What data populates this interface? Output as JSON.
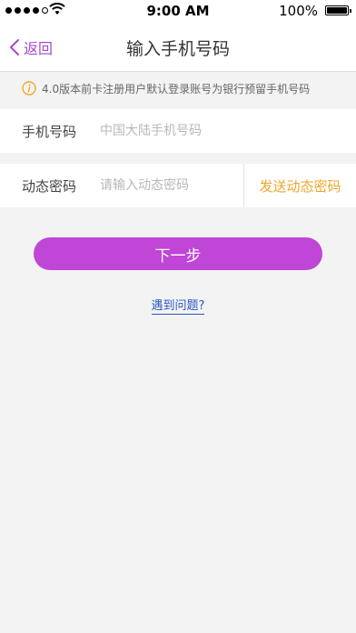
{
  "status_bar": {
    "time": "9:00 AM",
    "battery": "100%",
    "battery_level": 1.0,
    "signal_bars_filled": 4,
    "signal_bars_total": 5
  },
  "nav": {
    "back_label": "返回",
    "title": "输入手机号码",
    "back_icon": "chevron-left-icon",
    "accent_color": "#a64bc8"
  },
  "notice": {
    "icon": "info-icon",
    "text": "4.0版本前卡注册用户默认登录账号为银行预留手机号码"
  },
  "form": {
    "phone_label": "手机号码",
    "phone_value": "",
    "phone_placeholder": "中国大陆手机号码",
    "code_label": "动态密码",
    "code_value": "",
    "code_placeholder": "请输入动态密码",
    "send_code_label": "发送动态密码",
    "send_code_color": "#f2a62c"
  },
  "actions": {
    "next_label": "下一步",
    "next_color": "#bf46d6",
    "help_label": "遇到问题?"
  }
}
